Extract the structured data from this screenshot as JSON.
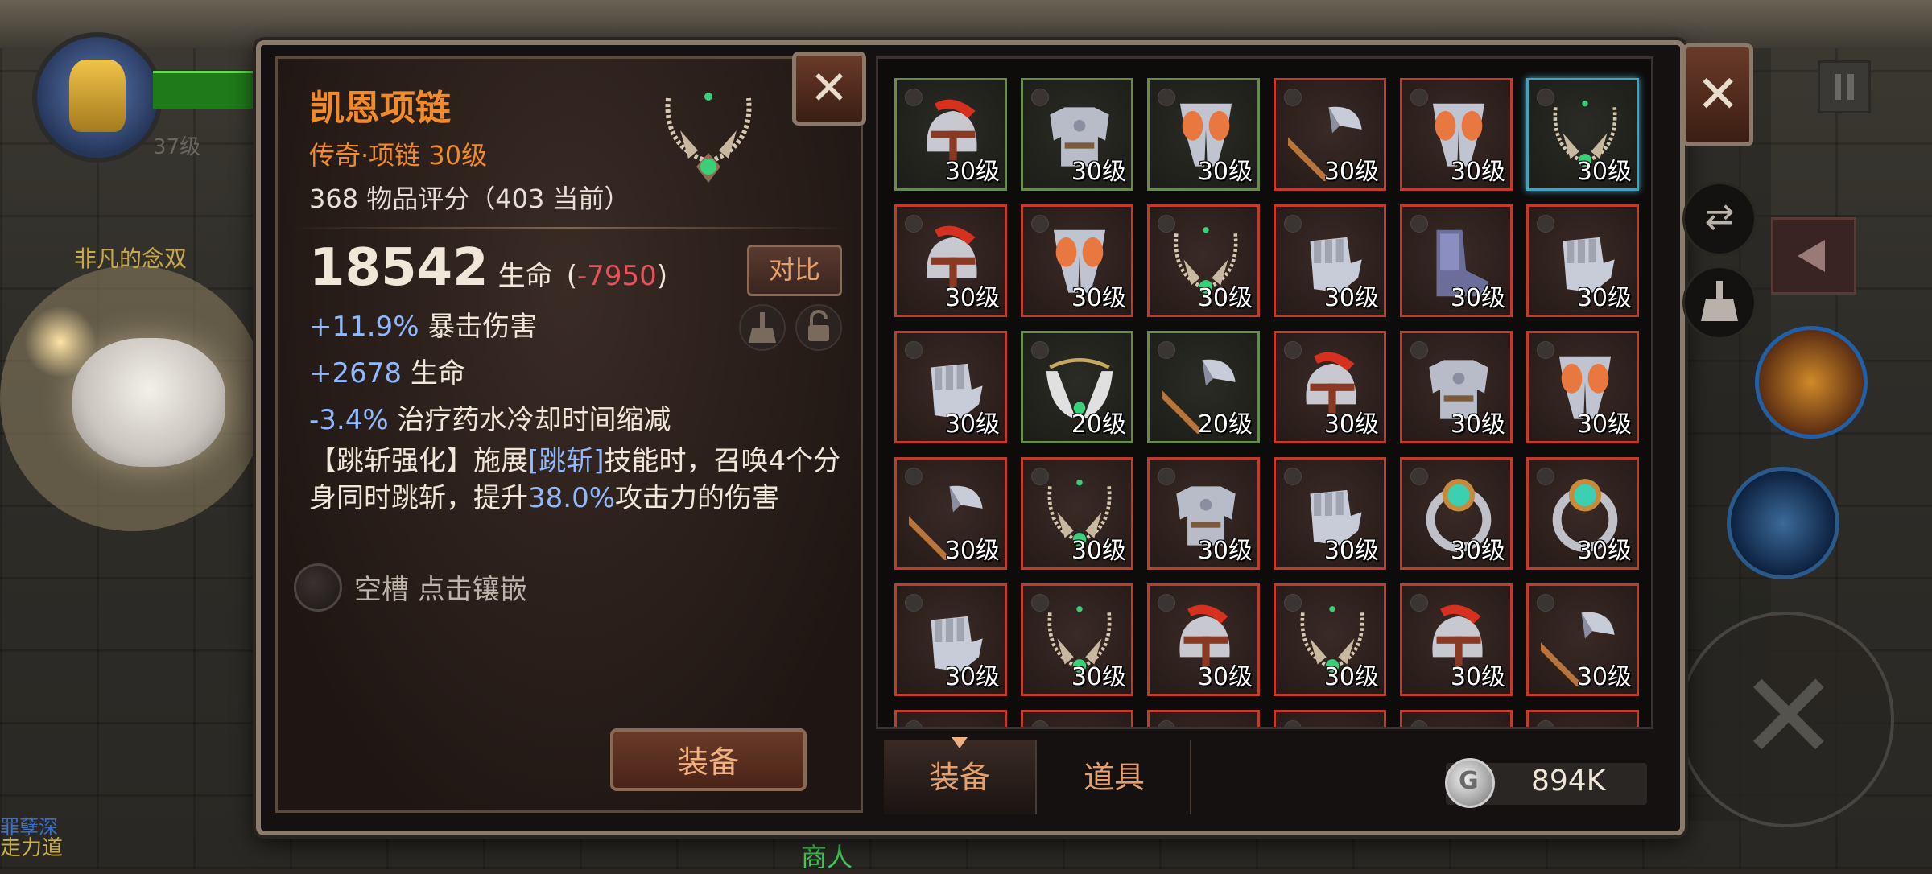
{
  "world": {
    "player_level": "37级",
    "player_name": "非凡的念双",
    "bottom_left_line1": "罪孽深",
    "bottom_left_line2": "走力道",
    "merchant": "商人"
  },
  "detail": {
    "name": "凯恩项链",
    "rarity_line": "传奇·项链 30级",
    "score_line": "368 物品评分（403 当前）",
    "main_value": "18542",
    "main_label": "生命",
    "main_diff_open": "(",
    "main_diff": "-7950",
    "main_diff_close": ")",
    "stats": [
      {
        "value": "+11.9%",
        "label": "暴击伤害"
      },
      {
        "value": "+2678",
        "label": "生命"
      },
      {
        "value": "-3.4%",
        "label": "治疗药水冷却时间缩减"
      }
    ],
    "skill_part1": "【跳斩强化】施展",
    "skill_hl1": "[跳斩]",
    "skill_part2": "技能时，召唤4个分身同时跳斩，提升",
    "skill_hl2": "38.0%",
    "skill_part3": "攻击力的伤害",
    "socket_text": "空槽 点击镶嵌",
    "compare_label": "对比",
    "equip_label": "装备",
    "close_label": "✕"
  },
  "inventory": {
    "slots": [
      {
        "type": "helmet",
        "level": "30级",
        "frame": "green"
      },
      {
        "type": "armor",
        "level": "30级",
        "frame": "green"
      },
      {
        "type": "legs",
        "level": "30级",
        "frame": "green"
      },
      {
        "type": "axe",
        "level": "30级",
        "frame": "red"
      },
      {
        "type": "legs",
        "level": "30级",
        "frame": "red"
      },
      {
        "type": "necklace",
        "level": "30级",
        "frame": "selected"
      },
      {
        "type": "helmet",
        "level": "30级",
        "frame": "red"
      },
      {
        "type": "legs",
        "level": "30级",
        "frame": "red"
      },
      {
        "type": "necklace",
        "level": "30级",
        "frame": "red"
      },
      {
        "type": "gauntlet",
        "level": "30级",
        "frame": "red"
      },
      {
        "type": "boots",
        "level": "30级",
        "frame": "red"
      },
      {
        "type": "gauntlet",
        "level": "30级",
        "frame": "red"
      },
      {
        "type": "gauntlet",
        "level": "30级",
        "frame": "red"
      },
      {
        "type": "wing-necklace",
        "level": "20级",
        "frame": "green"
      },
      {
        "type": "axe",
        "level": "20级",
        "frame": "green"
      },
      {
        "type": "helmet",
        "level": "30级",
        "frame": "red"
      },
      {
        "type": "armor",
        "level": "30级",
        "frame": "red"
      },
      {
        "type": "legs",
        "level": "30级",
        "frame": "red"
      },
      {
        "type": "axe",
        "level": "30级",
        "frame": "red"
      },
      {
        "type": "necklace",
        "level": "30级",
        "frame": "red"
      },
      {
        "type": "armor",
        "level": "30级",
        "frame": "red"
      },
      {
        "type": "gauntlet",
        "level": "30级",
        "frame": "red"
      },
      {
        "type": "ring",
        "level": "30级",
        "frame": "red"
      },
      {
        "type": "ring",
        "level": "30级",
        "frame": "red"
      },
      {
        "type": "gauntlet",
        "level": "30级",
        "frame": "red"
      },
      {
        "type": "necklace",
        "level": "30级",
        "frame": "red"
      },
      {
        "type": "helmet",
        "level": "30级",
        "frame": "red"
      },
      {
        "type": "necklace",
        "level": "30级",
        "frame": "red"
      },
      {
        "type": "helmet",
        "level": "30级",
        "frame": "red"
      },
      {
        "type": "axe",
        "level": "30级",
        "frame": "red"
      },
      {
        "type": "helmet",
        "level": "",
        "frame": "red"
      },
      {
        "type": "boots",
        "level": "",
        "frame": "red"
      },
      {
        "type": "necklace",
        "level": "",
        "frame": "red"
      },
      {
        "type": "axe",
        "level": "",
        "frame": "red"
      },
      {
        "type": "helmet",
        "level": "",
        "frame": "red"
      },
      {
        "type": "axe",
        "level": "",
        "frame": "red"
      }
    ]
  },
  "tabs": {
    "equipment": "装备",
    "items": "道具"
  },
  "currency": {
    "value": "894K"
  },
  "colors": {
    "legendary": "#f08a2a",
    "stat_value": "#8fb8ff",
    "negative": "#e9505a",
    "frame_red": "#c23a2a",
    "frame_green": "#6a8a4a"
  }
}
